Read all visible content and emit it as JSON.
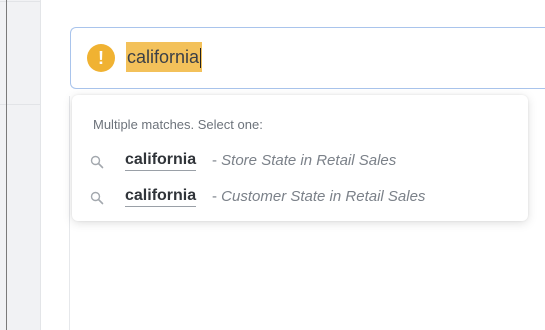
{
  "search": {
    "query": "california",
    "status_icon": "warning-icon",
    "status_glyph": "!",
    "accent_color": "#f0b232",
    "highlight_color": "#f3c15a"
  },
  "dropdown": {
    "header": "Multiple matches. Select one:",
    "matches": [
      {
        "term": "california",
        "separator": "-",
        "description": "Store State in Retail Sales",
        "icon": "search-icon"
      },
      {
        "term": "california",
        "separator": "-",
        "description": "Customer State in Retail Sales",
        "icon": "search-icon"
      }
    ]
  }
}
